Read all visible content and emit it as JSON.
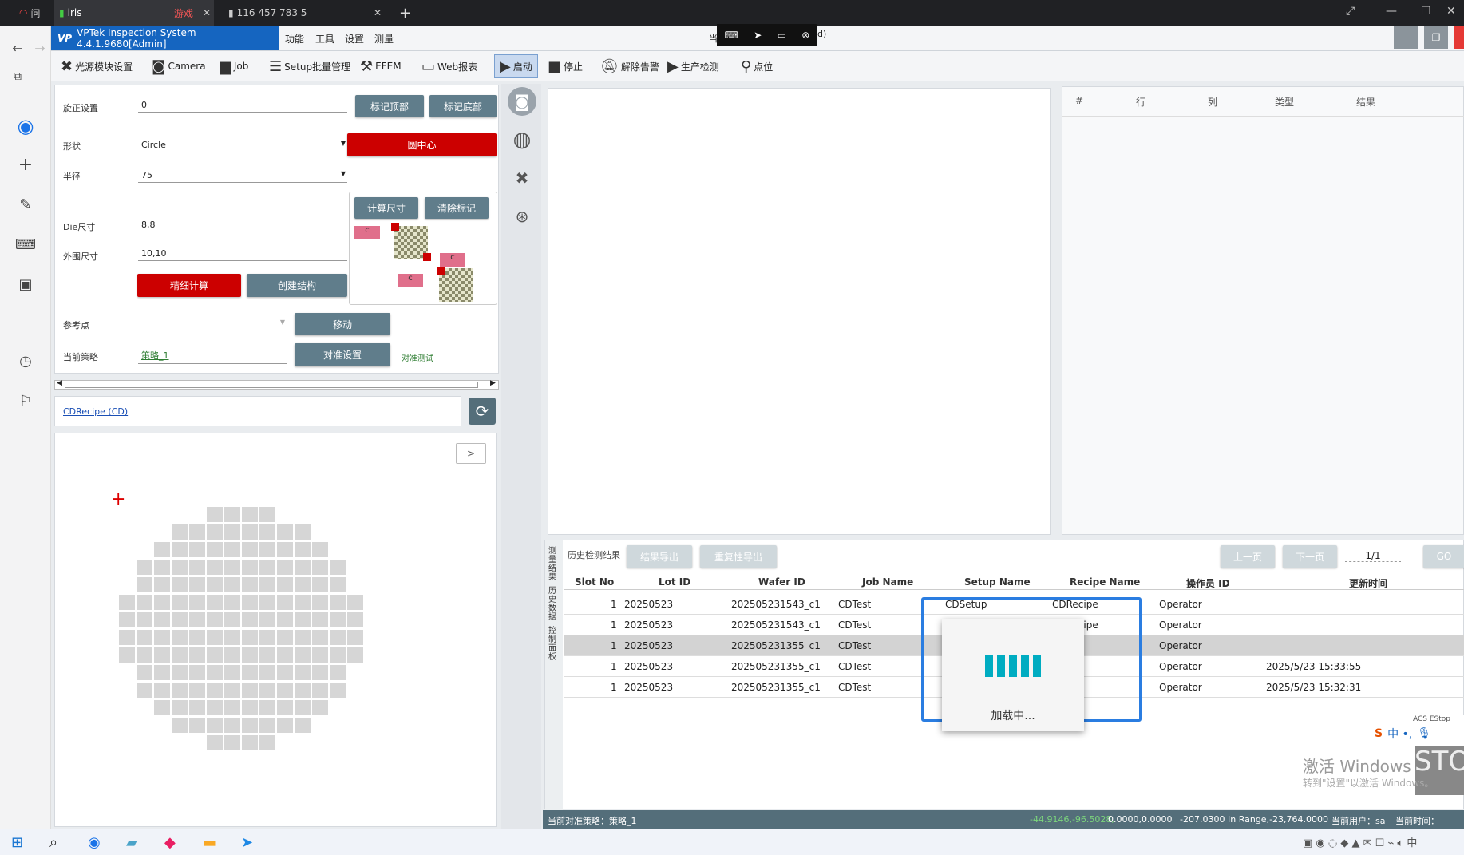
{
  "browser": {
    "tabs": [
      {
        "label": "问",
        "x": "40"
      },
      {
        "label": "iris"
      },
      {
        "label": "游戏"
      },
      {
        "label": "116 457 783 5"
      }
    ],
    "new_tab": "+",
    "overlay_text": "当",
    "overlay_tail": "d)"
  },
  "app": {
    "title": "VPTek Inspection System 4.4.1.9680[Admin]",
    "menus": [
      "功能",
      "工具",
      "设置",
      "测量"
    ],
    "toolbar": [
      "光源模块设置",
      "Camera",
      "Job",
      "Setup批量管理",
      "EFEM",
      "Web报表",
      "启动",
      "停止",
      "解除告警",
      "生产检测",
      "点位"
    ]
  },
  "setup": {
    "rotation_label": "旋正设置",
    "rotation_value": "0",
    "mark_top": "标记顶部",
    "mark_bottom": "标记底部",
    "shape_label": "形状",
    "shape_value": "Circle",
    "circle_center": "圆中心",
    "radius_label": "半径",
    "radius_value": "75",
    "calc_size": "计算尺寸",
    "clear_mark": "清除标记",
    "die_label": "Die尺寸",
    "die_value": "8,8",
    "outer_label": "外围尺寸",
    "outer_value": "10,10",
    "fine_calc": "精细计算",
    "create_struct": "创建结构",
    "ref_label": "参考点",
    "ref_value": "",
    "move": "移动",
    "strategy_label": "当前策略",
    "strategy_value": "策略_1",
    "align_setup": "对准设置",
    "align_test": "对准测试",
    "c_label": "c"
  },
  "recipe": {
    "link": "CDRecipe (CD)"
  },
  "wafer": {
    "nav": ">",
    "marker": "+"
  },
  "right_table": {
    "headers": [
      "#",
      "行",
      "列",
      "类型",
      "结果"
    ]
  },
  "history": {
    "side_tabs": [
      "测量结果",
      "历史数据",
      "控制面板"
    ],
    "title": "历史检测结果",
    "export_results": "结果导出",
    "export_repeat": "重复性导出",
    "prev": "上一页",
    "next": "下一页",
    "page": "1/1",
    "go": "GO",
    "headers": [
      "Slot No",
      "Lot ID",
      "Wafer ID",
      "Job Name",
      "Setup Name",
      "Recipe Name",
      "操作员 ID",
      "更新时间"
    ],
    "rows": [
      {
        "slot": "1",
        "lot": "20250523",
        "wafer": "202505231543_c1",
        "job": "CDTest",
        "setup": "CDSetup",
        "recipe": "CDRecipe",
        "op": "Operator",
        "time": ""
      },
      {
        "slot": "1",
        "lot": "20250523",
        "wafer": "202505231543_c1",
        "job": "CDTest",
        "setup": "CDSet",
        "recipe": "CDRecipe",
        "op": "Operator",
        "time": ""
      },
      {
        "slot": "1",
        "lot": "20250523",
        "wafer": "202505231355_c1",
        "job": "CDTest",
        "setup": "",
        "recipe": "pe",
        "op": "Operator",
        "time": ""
      },
      {
        "slot": "1",
        "lot": "20250523",
        "wafer": "202505231355_c1",
        "job": "CDTest",
        "setup": "",
        "recipe": "pe",
        "op": "Operator",
        "time": "2025/5/23 15:33:55"
      },
      {
        "slot": "1",
        "lot": "20250523",
        "wafer": "202505231355_c1",
        "job": "CDTest",
        "setup": "",
        "recipe": "pe",
        "op": "Operator",
        "time": "2025/5/23 15:32:31"
      }
    ],
    "loading": "加载中..."
  },
  "windows": {
    "line1": "激活 Windows",
    "line2": "转到\"设置\"以激活 Windows。",
    "acs": "ACS EStop",
    "stop": "STO",
    "ime": "中 •,"
  },
  "status": {
    "strategy": "当前对准策略：策略_1",
    "coords_green": "-44.9146,-96.5028,",
    "coords": "0.0000,0.0000",
    "z": "-207.0300",
    "range": "In Range,-23,764.0000",
    "user": "当前用户：sa",
    "time": "当前时间：16:13"
  },
  "colors": {
    "accent": "#1565c0",
    "red_button": "#cc0000",
    "grey_button": "#607d8b",
    "status_bar": "#546e7a"
  }
}
